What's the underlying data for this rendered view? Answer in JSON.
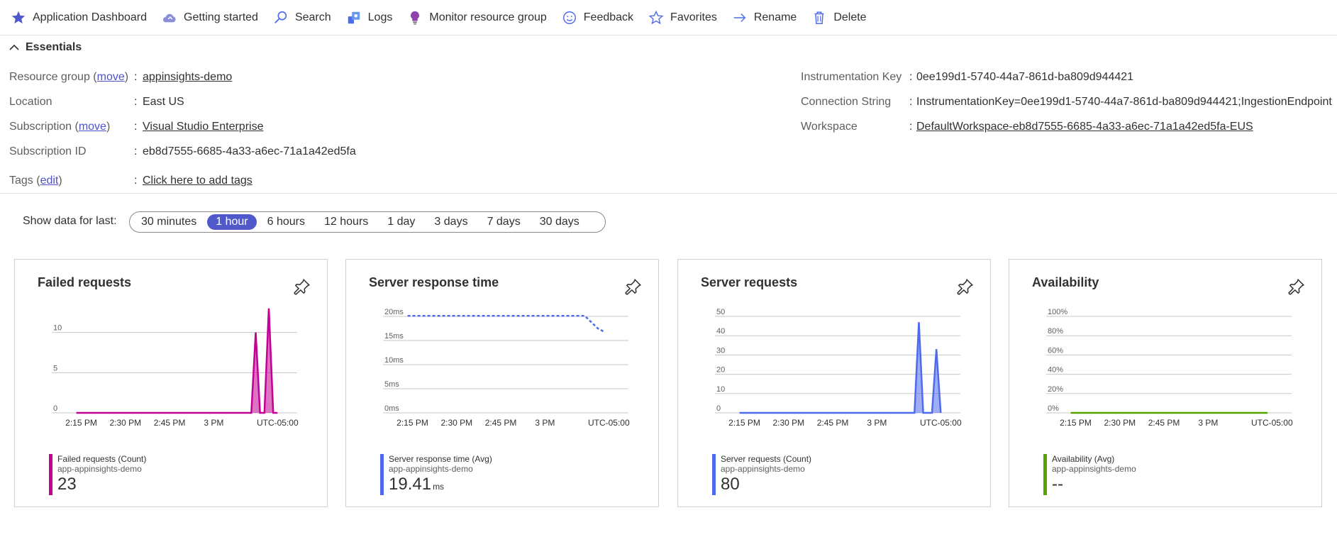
{
  "toolbar": {
    "items": [
      {
        "label": "Application Dashboard",
        "icon": "star-filled-icon"
      },
      {
        "label": "Getting started",
        "icon": "cloud-icon"
      },
      {
        "label": "Search",
        "icon": "search-icon"
      },
      {
        "label": "Logs",
        "icon": "logs-icon"
      },
      {
        "label": "Monitor resource group",
        "icon": "lightbulb-icon"
      },
      {
        "label": "Feedback",
        "icon": "smiley-icon"
      },
      {
        "label": "Favorites",
        "icon": "star-outline-icon"
      },
      {
        "label": "Rename",
        "icon": "arrow-right-icon"
      },
      {
        "label": "Delete",
        "icon": "trash-icon"
      }
    ]
  },
  "essentials": {
    "header": "Essentials",
    "left": {
      "resource_group_label": "Resource group",
      "resource_group_move": "move",
      "resource_group_value": "appinsights-demo",
      "location_label": "Location",
      "location_value": "East US",
      "subscription_label": "Subscription",
      "subscription_move": "move",
      "subscription_value": "Visual Studio Enterprise",
      "subscription_id_label": "Subscription ID",
      "subscription_id_value": "eb8d7555-6685-4a33-a6ec-71a1a42ed5fa",
      "tags_label": "Tags",
      "tags_edit": "edit",
      "tags_value": "Click here to add tags"
    },
    "right": {
      "ikey_label": "Instrumentation Key",
      "ikey_value": "0ee199d1-5740-44a7-861d-ba809d944421",
      "conn_label": "Connection String",
      "conn_value": "InstrumentationKey=0ee199d1-5740-44a7-861d-ba809d944421;IngestionEndpoint",
      "workspace_label": "Workspace",
      "workspace_value": "DefaultWorkspace-eb8d7555-6685-4a33-a6ec-71a1a42ed5fa-EUS"
    }
  },
  "time_range": {
    "label": "Show data for last:",
    "options": [
      "30 minutes",
      "1 hour",
      "6 hours",
      "12 hours",
      "1 day",
      "3 days",
      "7 days",
      "30 days"
    ],
    "selected": "1 hour"
  },
  "colors": {
    "accent": "#5059c9",
    "failed": "#c30094",
    "blue": "#4f6bed",
    "green": "#57a300"
  },
  "cards": [
    {
      "title": "Failed requests",
      "legend_name": "Failed requests (Count)",
      "legend_sub": "app-appinsights-demo",
      "legend_value": "23",
      "legend_unit": ""
    },
    {
      "title": "Server response time",
      "legend_name": "Server response time (Avg)",
      "legend_sub": "app-appinsights-demo",
      "legend_value": "19.41",
      "legend_unit": "ms"
    },
    {
      "title": "Server requests",
      "legend_name": "Server requests (Count)",
      "legend_sub": "app-appinsights-demo",
      "legend_value": "80",
      "legend_unit": ""
    },
    {
      "title": "Availability",
      "legend_name": "Availability (Avg)",
      "legend_sub": "app-appinsights-demo",
      "legend_value": "--",
      "legend_unit": ""
    }
  ],
  "chart_data": [
    {
      "type": "area",
      "title": "Failed requests",
      "x_ticks": [
        "2:15 PM",
        "2:30 PM",
        "2:45 PM",
        "3 PM",
        "UTC-05:00"
      ],
      "y_ticks": [
        "0",
        "5",
        "10"
      ],
      "ylim": [
        0,
        12
      ],
      "color": "#c30094",
      "series": [
        {
          "name": "Failed requests (Count)",
          "x": [
            0,
            0.8,
            0.82,
            0.84,
            0.86,
            0.88,
            0.9,
            0.92
          ],
          "y": [
            0,
            0,
            10,
            0,
            0,
            13,
            0,
            0
          ]
        }
      ]
    },
    {
      "type": "line",
      "title": "Server response time",
      "x_ticks": [
        "2:15 PM",
        "2:30 PM",
        "2:45 PM",
        "3 PM",
        "UTC-05:00"
      ],
      "y_ticks": [
        "0ms",
        "5ms",
        "10ms",
        "15ms",
        "20ms"
      ],
      "ylim": [
        0,
        20
      ],
      "dashed": true,
      "color": "#4f6bed",
      "series": [
        {
          "name": "Server response time (Avg)",
          "x": [
            0,
            0.81,
            0.87,
            0.9
          ],
          "y": [
            20.1,
            20.1,
            17.5,
            16.8
          ]
        }
      ]
    },
    {
      "type": "area",
      "title": "Server requests",
      "x_ticks": [
        "2:15 PM",
        "2:30 PM",
        "2:45 PM",
        "3 PM",
        "UTC-05:00"
      ],
      "y_ticks": [
        "0",
        "10",
        "20",
        "30",
        "40",
        "50"
      ],
      "ylim": [
        0,
        50
      ],
      "color": "#4f6bed",
      "series": [
        {
          "name": "Server requests (Count)",
          "x": [
            0,
            0.8,
            0.82,
            0.84,
            0.88,
            0.9,
            0.92
          ],
          "y": [
            0,
            0,
            47,
            0,
            0,
            33,
            0
          ]
        }
      ]
    },
    {
      "type": "line",
      "title": "Availability",
      "x_ticks": [
        "2:15 PM",
        "2:30 PM",
        "2:45 PM",
        "3 PM",
        "UTC-05:00"
      ],
      "y_ticks": [
        "0%",
        "20%",
        "40%",
        "60%",
        "80%",
        "100%"
      ],
      "ylim": [
        0,
        100
      ],
      "color": "#57a300",
      "series": [
        {
          "name": "Availability (Avg)",
          "x": [
            0,
            0.9
          ],
          "y": [
            0,
            0
          ]
        }
      ]
    }
  ]
}
